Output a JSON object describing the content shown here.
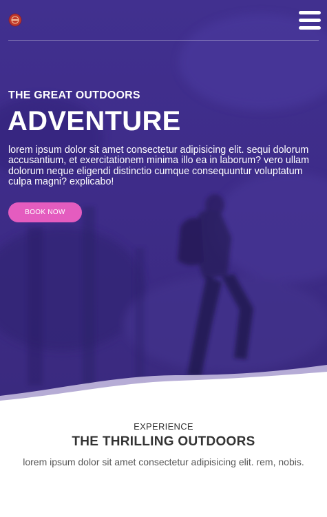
{
  "header": {
    "logo_icon": "logo-emblem-icon",
    "menu_icon": "hamburger-menu-icon"
  },
  "hero": {
    "subtitle": "THE GREAT OUTDOORS",
    "title": "ADVENTURE",
    "description": "lorem ipsum dolor sit amet consectetur adipisicing elit. sequi dolorum accusantium, et exercitationem minima illo ea in laborum? vero ullam dolorum neque eligendi distinctio cumque consequuntur voluptatum culpa magni? explicabo!",
    "cta_label": "BOOK NOW"
  },
  "section": {
    "kicker": "EXPERIENCE",
    "title": "THE THRILLING OUTDOORS",
    "text": "lorem ipsum dolor sit amet consectetur adipisicing elit. rem, nobis."
  },
  "colors": {
    "hero_overlay": "#3d2a8c",
    "accent": "#e45cbf",
    "text_dark": "#333333"
  }
}
